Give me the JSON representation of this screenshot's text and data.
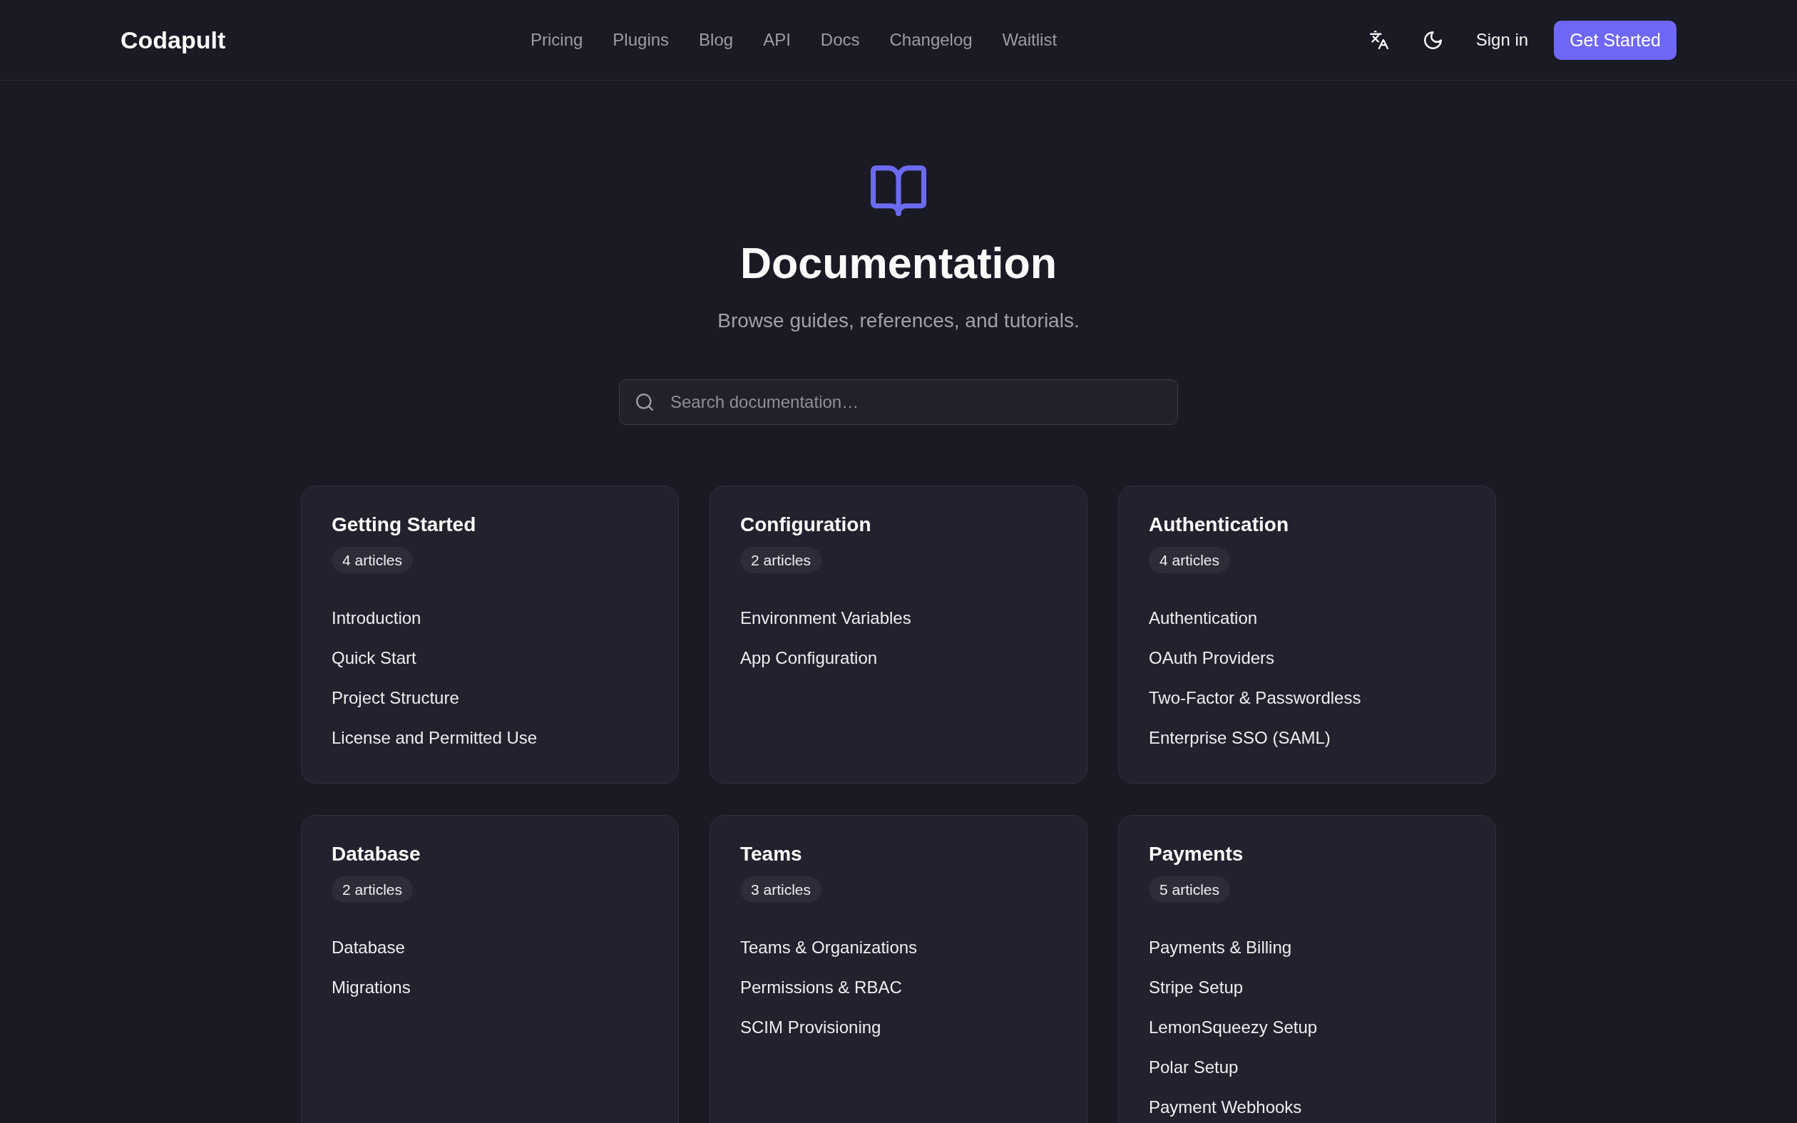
{
  "header": {
    "logo": "Codapult",
    "nav": [
      "Pricing",
      "Plugins",
      "Blog",
      "API",
      "Docs",
      "Changelog",
      "Waitlist"
    ],
    "sign_in": "Sign in",
    "get_started": "Get Started"
  },
  "hero": {
    "title": "Documentation",
    "subtitle": "Browse guides, references, and tutorials.",
    "search": {
      "placeholder": "Search documentation…"
    }
  },
  "categories": [
    {
      "title": "Getting Started",
      "count": "4 articles",
      "articles": [
        "Introduction",
        "Quick Start",
        "Project Structure",
        "License and Permitted Use"
      ]
    },
    {
      "title": "Configuration",
      "count": "2 articles",
      "articles": [
        "Environment Variables",
        "App Configuration"
      ]
    },
    {
      "title": "Authentication",
      "count": "4 articles",
      "articles": [
        "Authentication",
        "OAuth Providers",
        "Two-Factor & Passwordless",
        "Enterprise SSO (SAML)"
      ]
    },
    {
      "title": "Database",
      "count": "2 articles",
      "articles": [
        "Database",
        "Migrations"
      ]
    },
    {
      "title": "Teams",
      "count": "3 articles",
      "articles": [
        "Teams & Organizations",
        "Permissions & RBAC",
        "SCIM Provisioning"
      ]
    },
    {
      "title": "Payments",
      "count": "5 articles",
      "articles": [
        "Payments & Billing",
        "Stripe Setup",
        "LemonSqueezy Setup",
        "Polar Setup",
        "Payment Webhooks"
      ]
    }
  ]
}
